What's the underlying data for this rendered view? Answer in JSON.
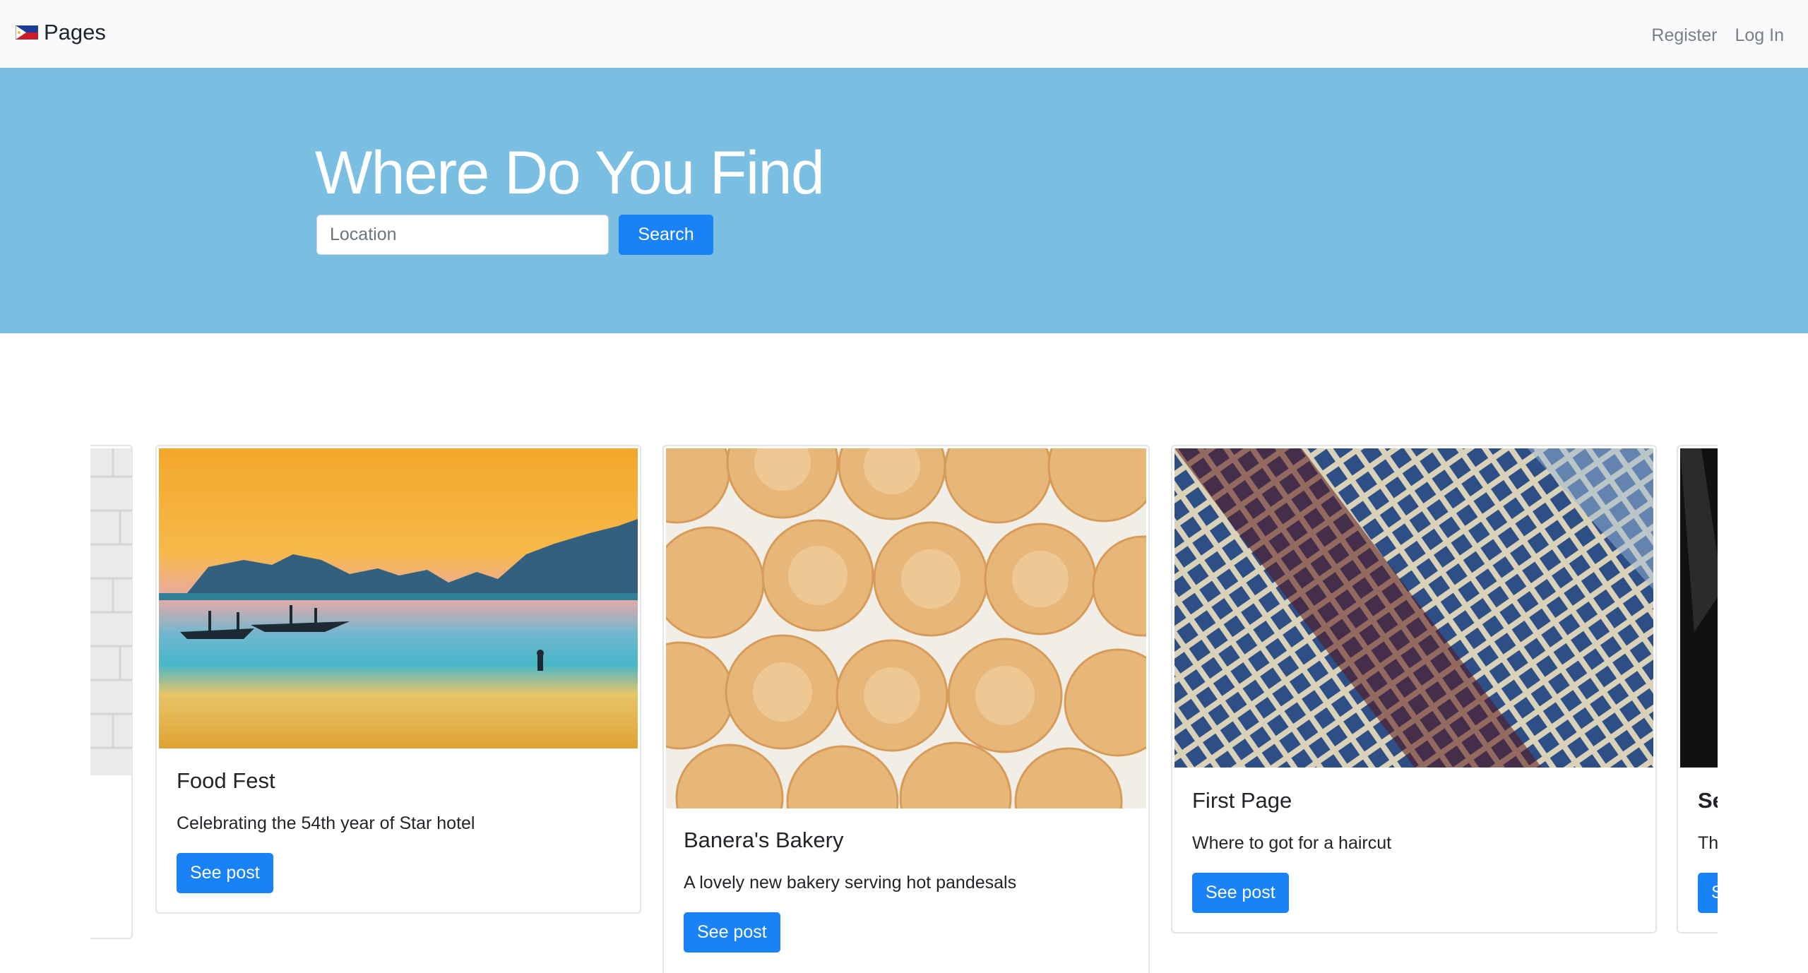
{
  "navbar": {
    "brand": "Pages",
    "links": [
      "Register",
      "Log In"
    ]
  },
  "hero": {
    "title": "Where Do You Find",
    "search_placeholder": "Location",
    "search_button": "Search"
  },
  "cards": [
    {
      "title": "Food Fest",
      "text": "Celebrating the 54th year of Star hotel",
      "button": "See post",
      "image": "beach-sunset-boats"
    },
    {
      "title": "Banera's Bakery",
      "text": "A lovely new bakery serving hot pandesals",
      "button": "See post",
      "image": "pandesal-bread-rolls"
    },
    {
      "title": "First Page",
      "text": "Where to got for a haircut",
      "button": "See post",
      "image": "building-facade-windows"
    },
    {
      "title": "Se",
      "text": "Th",
      "button": "S",
      "image": "dark-abstract"
    }
  ],
  "colors": {
    "hero_bg": "#7abfe1",
    "primary": "#1a82f7",
    "navbar_bg": "#f8f9fa"
  }
}
